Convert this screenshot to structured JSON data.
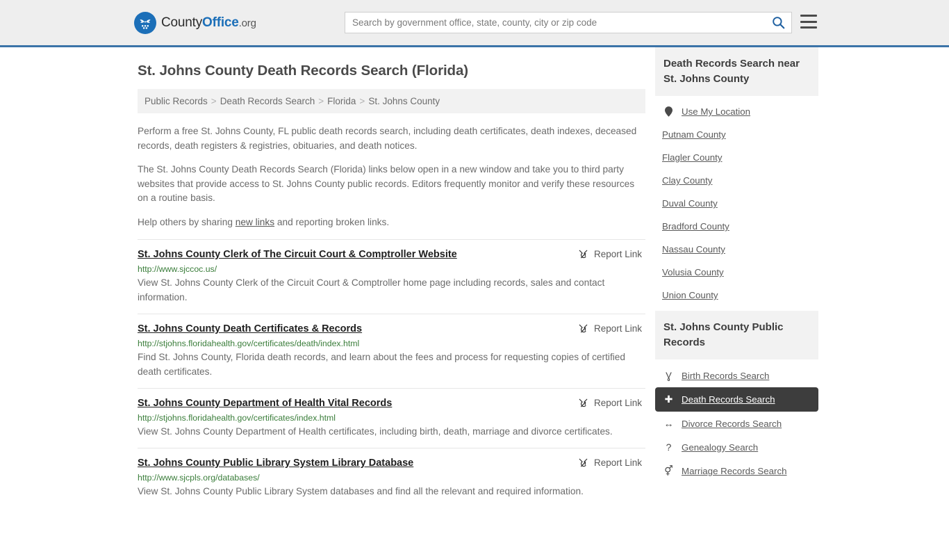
{
  "header": {
    "brand": {
      "part1": "County",
      "part2": "Office",
      "part3": ".org"
    },
    "search": {
      "placeholder": "Search by government office, state, county, city or zip code",
      "value": ""
    },
    "accent_color": "#1c6fb8",
    "border_color": "#3b73a8"
  },
  "page": {
    "title": "St. Johns County Death Records Search (Florida)"
  },
  "breadcrumb": {
    "items": [
      {
        "label": "Public Records"
      },
      {
        "label": "Death Records Search"
      },
      {
        "label": "Florida"
      },
      {
        "label": "St. Johns County"
      }
    ],
    "separator": ">"
  },
  "intro": {
    "p1": "Perform a free St. Johns County, FL public death records search, including death certificates, death indexes, deceased records, death registers & registries, obituaries, and death notices.",
    "p2": "The St. Johns County Death Records Search (Florida) links below open in a new window and take you to third party websites that provide access to St. Johns County public records. Editors frequently monitor and verify these resources on a routine basis.",
    "p3_before": "Help others by sharing ",
    "p3_link": "new links",
    "p3_after": " and reporting broken links."
  },
  "results": {
    "report_label": "Report Link",
    "items": [
      {
        "title": "St. Johns County Clerk of The Circuit Court & Comptroller Website",
        "url": "http://www.sjccoc.us/",
        "description": "View St. Johns County Clerk of the Circuit Court & Comptroller home page including records, sales and contact information."
      },
      {
        "title": "St. Johns County Death Certificates & Records",
        "url": "http://stjohns.floridahealth.gov/certificates/death/index.html",
        "description": "Find St. Johns County, Florida death records, and learn about the fees and process for requesting copies of certified death certificates."
      },
      {
        "title": "St. Johns County Department of Health Vital Records",
        "url": "http://stjohns.floridahealth.gov/certificates/index.html",
        "description": "View St. Johns County Department of Health certificates, including birth, death, marriage and divorce certificates."
      },
      {
        "title": "St. Johns County Public Library System Library Database",
        "url": "http://www.sjcpls.org/databases/",
        "description": "View St. Johns County Public Library System databases and find all the relevant and required information."
      }
    ]
  },
  "sidebar": {
    "nearby": {
      "heading": "Death Records Search near St. Johns County",
      "items": [
        {
          "label": "Use My Location",
          "icon": "map-pin-icon"
        },
        {
          "label": "Putnam County",
          "icon": ""
        },
        {
          "label": "Flagler County",
          "icon": ""
        },
        {
          "label": "Clay County",
          "icon": ""
        },
        {
          "label": "Duval County",
          "icon": ""
        },
        {
          "label": "Bradford County",
          "icon": ""
        },
        {
          "label": "Nassau County",
          "icon": ""
        },
        {
          "label": "Volusia County",
          "icon": ""
        },
        {
          "label": "Union County",
          "icon": ""
        }
      ]
    },
    "public_records": {
      "heading": "St. Johns County Public Records",
      "active_color": "#3d3d3d",
      "items": [
        {
          "label": "Birth Records Search",
          "icon": "baby-icon",
          "glyph": "Ɣ",
          "active": false
        },
        {
          "label": "Death Records Search",
          "icon": "cross-icon",
          "glyph": "✚",
          "active": true
        },
        {
          "label": "Divorce Records Search",
          "icon": "left-right-arrow-icon",
          "glyph": "↔",
          "active": false
        },
        {
          "label": "Genealogy Search",
          "icon": "question-mark-icon",
          "glyph": "?",
          "active": false
        },
        {
          "label": "Marriage Records Search",
          "icon": "male-female-icon",
          "glyph": "⚥",
          "active": false
        }
      ]
    }
  }
}
